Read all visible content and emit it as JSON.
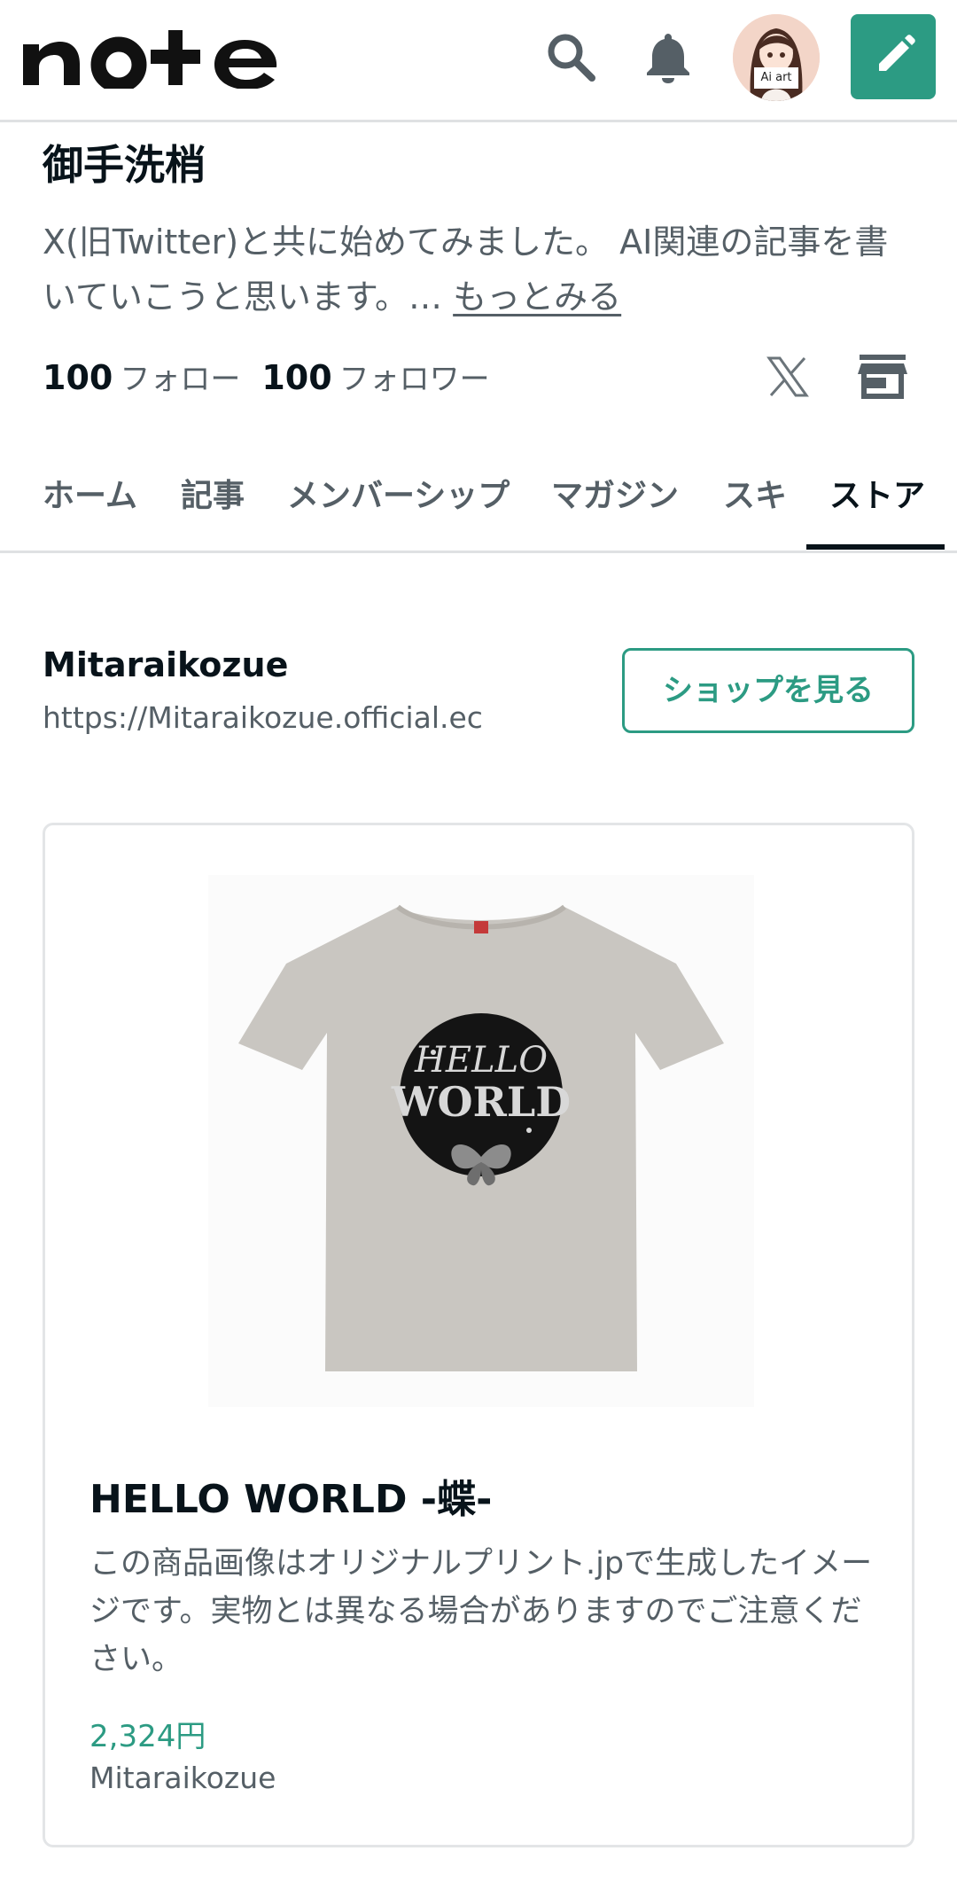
{
  "header": {
    "logo": "note",
    "avatar_tag": "Ai art",
    "icons": [
      "search-icon",
      "bell-icon",
      "pencil-icon"
    ]
  },
  "profile": {
    "name": "御手洗梢",
    "bio": "X(旧Twitter)と共に始めてみました。 AI関連の記事を書いていこうと思います。… ",
    "more_label": "もっとみる",
    "follow_count": "100",
    "follow_label": "フォロー",
    "follower_count": "100",
    "follower_label": "フォロワー"
  },
  "tabs": [
    {
      "label": "ホーム"
    },
    {
      "label": "記事"
    },
    {
      "label": "メンバーシップ"
    },
    {
      "label": "マガジン"
    },
    {
      "label": "スキ"
    },
    {
      "label": "ストア",
      "active": true
    }
  ],
  "shop": {
    "name": "Mitaraikozue",
    "url": "https://Mitaraikozue.official.ec",
    "button_label": "ショップを見る"
  },
  "product": {
    "title": "HELLO WORLD -蝶-",
    "description": "この商品画像はオリジナルプリント.jpで生成したイメージです。実物とは異なる場合がありますのでご注意ください。",
    "price": "2,324円",
    "seller": "Mitaraikozue",
    "print_text_line1": "HELLO",
    "print_text_line2": "WORLD"
  },
  "colors": {
    "accent": "#2c9b83",
    "text": "#08131a",
    "muted": "#555f66",
    "border": "#dfe1e3"
  }
}
